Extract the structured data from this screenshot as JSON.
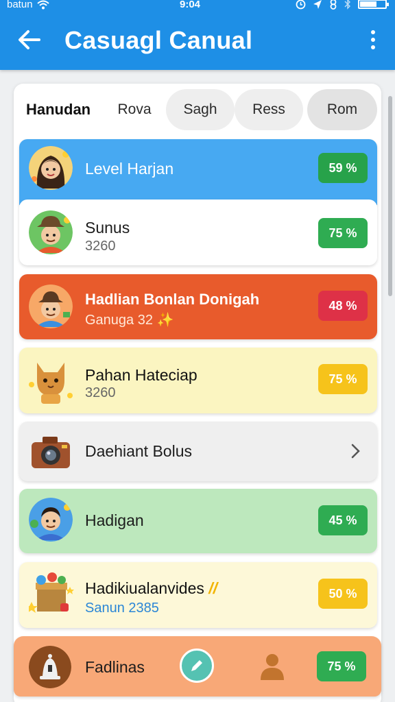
{
  "status_bar": {
    "carrier": "batun",
    "time": "9:04"
  },
  "app_bar": {
    "title": "Casuagl Canual",
    "back_icon": "arrow-left-icon",
    "menu_icon": "more-vert-icon"
  },
  "tabs": [
    {
      "label": "Hanudan",
      "active": true
    },
    {
      "label": "Rova",
      "active": false
    },
    {
      "label": "Sagh",
      "active": false
    },
    {
      "label": "Ress",
      "active": false
    },
    {
      "label": "Rom",
      "active": false
    }
  ],
  "rows": [
    {
      "title": "Level Harjan",
      "subtitle": "",
      "badge": "59 %",
      "bg": "#47a9f2",
      "badge_color": "#27a24a",
      "avatar": "girl-avatar-icon"
    },
    {
      "title": "Sunus",
      "subtitle": "3260",
      "badge": "75 %",
      "bg": "#ffffff",
      "badge_color": "#2fac52",
      "avatar": "cowboy-avatar-icon"
    },
    {
      "title": "Hadlian Bonlan Donigah",
      "subtitle": "Ganuga 32",
      "subtitle_emoji": "✨",
      "badge": "48 %",
      "bg": "#e85b2c",
      "badge_color": "#de3147",
      "avatar": "gardener-avatar-icon"
    },
    {
      "title": "Pahan Hateciap",
      "subtitle": "3260",
      "badge": "75 %",
      "bg": "#fbf5c1",
      "badge_color": "#f6c31b",
      "avatar": "cat-avatar-icon"
    },
    {
      "title": "Daehiant Bolus",
      "subtitle": "",
      "badge": "",
      "bg": "#efefef",
      "badge_color": "",
      "avatar": "camera-icon"
    },
    {
      "title": "Hadigan",
      "subtitle": "",
      "badge": "45 %",
      "bg": "#bde8bd",
      "badge_color": "#2fac52",
      "avatar": "boy-avatar-icon"
    },
    {
      "title": "Hadikiualanvides",
      "title_emoji": "//",
      "subtitle": "Sanun 2385",
      "badge": "50 %",
      "bg": "#fdf8d8",
      "badge_color": "#f6c31b",
      "avatar": "gift-box-icon"
    },
    {
      "title": "Fadlinas",
      "subtitle": "",
      "badge": "75 %",
      "bg": "#f8a877",
      "badge_color": "#2fac52",
      "avatar": "bell-icon"
    }
  ],
  "bottom_icons": {
    "edit": "pencil-icon",
    "profile": "person-icon"
  }
}
